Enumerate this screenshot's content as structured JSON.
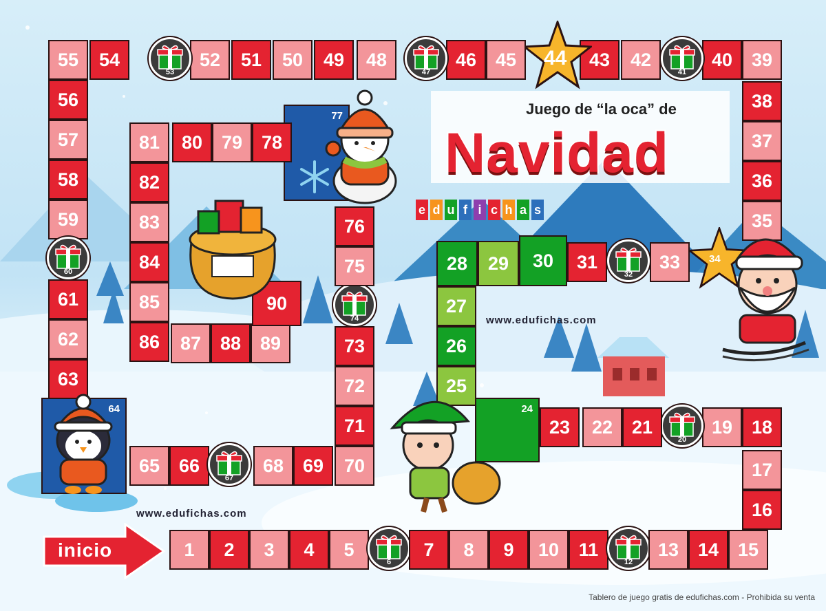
{
  "title": {
    "subtitle": "Juego de “la oca” de",
    "main": "Navidad"
  },
  "brand": {
    "letters": [
      "e",
      "d",
      "u",
      "f",
      "i",
      "c",
      "h",
      "a",
      "s"
    ],
    "colors": [
      "#e42331",
      "#f7941d",
      "#13a125",
      "#2c6fbb",
      "#8e3fae",
      "#e42331",
      "#f7941d",
      "#13a125",
      "#2c6fbb"
    ]
  },
  "urls": {
    "center": "www.edufichas.com",
    "left": "www.edufichas.com"
  },
  "start": {
    "label": "inicio"
  },
  "footer": "Tablero de juego gratis de edufichas.com - Prohibida su venta",
  "squares": [
    {
      "n": "1",
      "c": "p"
    },
    {
      "n": "2",
      "c": "r"
    },
    {
      "n": "3",
      "c": "p"
    },
    {
      "n": "4",
      "c": "r"
    },
    {
      "n": "5",
      "c": "p"
    },
    {
      "n": "6",
      "c": "gift"
    },
    {
      "n": "7",
      "c": "r"
    },
    {
      "n": "8",
      "c": "p"
    },
    {
      "n": "9",
      "c": "r"
    },
    {
      "n": "10",
      "c": "p"
    },
    {
      "n": "11",
      "c": "r"
    },
    {
      "n": "12",
      "c": "gift"
    },
    {
      "n": "13",
      "c": "p"
    },
    {
      "n": "14",
      "c": "r"
    },
    {
      "n": "15",
      "c": "p"
    },
    {
      "n": "16",
      "c": "r"
    },
    {
      "n": "17",
      "c": "p"
    },
    {
      "n": "18",
      "c": "r"
    },
    {
      "n": "19",
      "c": "p"
    },
    {
      "n": "20",
      "c": "gift"
    },
    {
      "n": "21",
      "c": "r"
    },
    {
      "n": "22",
      "c": "p"
    },
    {
      "n": "23",
      "c": "r"
    },
    {
      "n": "24",
      "c": "big"
    },
    {
      "n": "25",
      "c": "lg"
    },
    {
      "n": "26",
      "c": "g"
    },
    {
      "n": "27",
      "c": "lg"
    },
    {
      "n": "28",
      "c": "g"
    },
    {
      "n": "29",
      "c": "lg"
    },
    {
      "n": "30",
      "c": "g"
    },
    {
      "n": "31",
      "c": "r"
    },
    {
      "n": "32",
      "c": "gift"
    },
    {
      "n": "33",
      "c": "p"
    },
    {
      "n": "34",
      "c": "star"
    },
    {
      "n": "35",
      "c": "p"
    },
    {
      "n": "36",
      "c": "r"
    },
    {
      "n": "37",
      "c": "p"
    },
    {
      "n": "38",
      "c": "r"
    },
    {
      "n": "39",
      "c": "p"
    },
    {
      "n": "40",
      "c": "r"
    },
    {
      "n": "41",
      "c": "gift"
    },
    {
      "n": "42",
      "c": "p"
    },
    {
      "n": "43",
      "c": "r"
    },
    {
      "n": "44",
      "c": "star"
    },
    {
      "n": "45",
      "c": "p"
    },
    {
      "n": "46",
      "c": "r"
    },
    {
      "n": "47",
      "c": "gift"
    },
    {
      "n": "48",
      "c": "p"
    },
    {
      "n": "49",
      "c": "r"
    },
    {
      "n": "50",
      "c": "p"
    },
    {
      "n": "51",
      "c": "r"
    },
    {
      "n": "52",
      "c": "p"
    },
    {
      "n": "53",
      "c": "gift"
    },
    {
      "n": "54",
      "c": "r"
    },
    {
      "n": "55",
      "c": "p"
    },
    {
      "n": "56",
      "c": "r"
    },
    {
      "n": "57",
      "c": "p"
    },
    {
      "n": "58",
      "c": "r"
    },
    {
      "n": "59",
      "c": "p"
    },
    {
      "n": "60",
      "c": "gift"
    },
    {
      "n": "61",
      "c": "r"
    },
    {
      "n": "62",
      "c": "p"
    },
    {
      "n": "63",
      "c": "r"
    },
    {
      "n": "64",
      "c": "blue"
    },
    {
      "n": "65",
      "c": "p"
    },
    {
      "n": "66",
      "c": "r"
    },
    {
      "n": "67",
      "c": "gift"
    },
    {
      "n": "68",
      "c": "p"
    },
    {
      "n": "69",
      "c": "r"
    },
    {
      "n": "70",
      "c": "p"
    },
    {
      "n": "71",
      "c": "r"
    },
    {
      "n": "72",
      "c": "p"
    },
    {
      "n": "73",
      "c": "r"
    },
    {
      "n": "74",
      "c": "gift"
    },
    {
      "n": "75",
      "c": "p"
    },
    {
      "n": "76",
      "c": "r"
    },
    {
      "n": "77",
      "c": "blue"
    },
    {
      "n": "78",
      "c": "r"
    },
    {
      "n": "79",
      "c": "p"
    },
    {
      "n": "80",
      "c": "r"
    },
    {
      "n": "81",
      "c": "p"
    },
    {
      "n": "82",
      "c": "r"
    },
    {
      "n": "83",
      "c": "p"
    },
    {
      "n": "84",
      "c": "r"
    },
    {
      "n": "85",
      "c": "p"
    },
    {
      "n": "86",
      "c": "r"
    },
    {
      "n": "87",
      "c": "p"
    },
    {
      "n": "88",
      "c": "r"
    },
    {
      "n": "89",
      "c": "p"
    },
    {
      "n": "90",
      "c": "r"
    }
  ],
  "colors": {
    "red": "#e42331",
    "pink": "#f3959a",
    "green": "#13a125",
    "light_green": "#8cc63f",
    "blue": "#1f5aa8",
    "star": "#f7b52b"
  },
  "icons": {
    "gift": "gift-icon",
    "star": "star-icon",
    "snowflake": "snowflake-icon",
    "arrow": "arrow-right-icon"
  }
}
